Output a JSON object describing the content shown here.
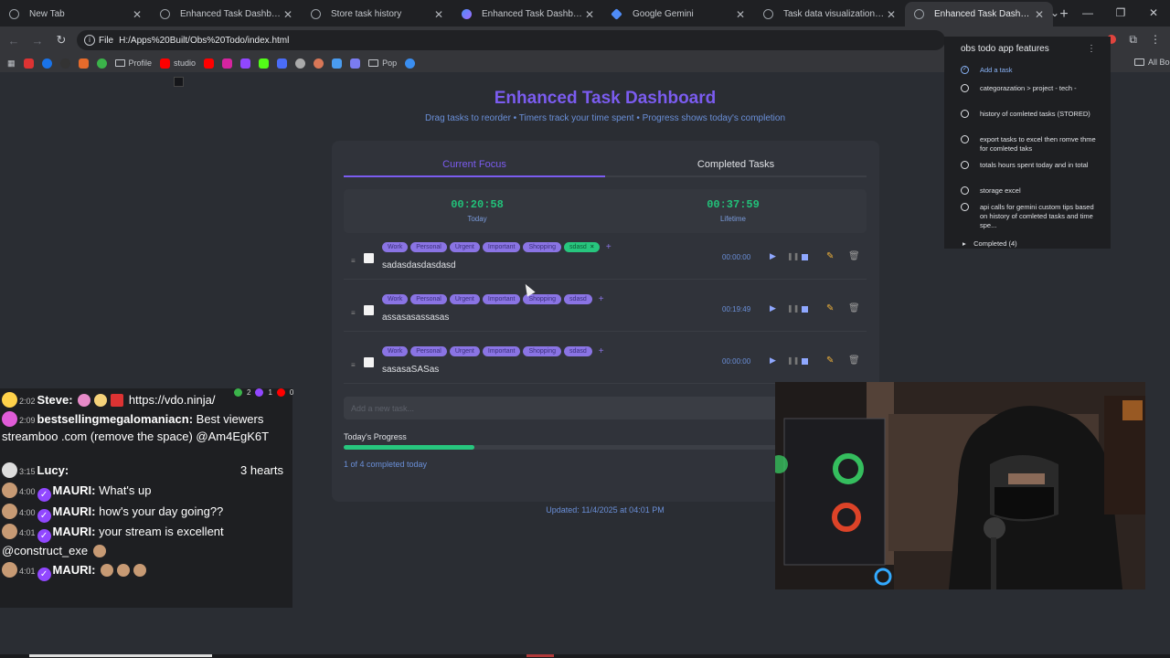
{
  "tabs": [
    {
      "title": "New Tab",
      "active": false,
      "fav": "globe-icon"
    },
    {
      "title": "Enhanced Task Dashboard (Dai",
      "active": false,
      "fav": "globe-icon"
    },
    {
      "title": "Store task history",
      "active": false,
      "fav": "globe-icon"
    },
    {
      "title": "Enhanced Task Dashboard with",
      "active": false,
      "fav": "app-icon"
    },
    {
      "title": "Google Gemini",
      "active": false,
      "fav": "gemini-icon"
    },
    {
      "title": "Task data visualization solution",
      "active": false,
      "fav": "globe-icon"
    },
    {
      "title": "Enhanced Task Dashboard (Dai",
      "active": true,
      "fav": "globe-icon"
    }
  ],
  "address": {
    "scheme": "File",
    "url": "H:/Apps%20Built/Obs%20Todo/index.html"
  },
  "bookmarks": [
    "Profile",
    "studio",
    "Pop",
    "All Bookmarks"
  ],
  "dashboard": {
    "title": "Enhanced Task Dashboard",
    "subtitle": "Drag tasks to reorder • Timers track your time spent • Progress shows today's completion",
    "tabs": {
      "current": "Current Focus",
      "completed": "Completed Tasks"
    },
    "timers": {
      "today_value": "00:20:58",
      "today_label": "Today",
      "lifetime_value": "00:37:59",
      "lifetime_label": "Lifetime"
    },
    "tags": [
      "Work",
      "Personal",
      "Urgent",
      "Important",
      "Shopping",
      "sdasd"
    ],
    "tasks": [
      {
        "name": "sadasdasdasdasd",
        "time": "00:00:00",
        "selected_tag": "sdasd"
      },
      {
        "name": "assasasassasas",
        "time": "00:19:49",
        "selected_tag": ""
      },
      {
        "name": "sasasaSASas",
        "time": "00:00:00",
        "selected_tag": ""
      }
    ],
    "new_task_placeholder": "Add a new task...",
    "progress": {
      "label": "Today's Progress",
      "fraction": 0.25,
      "text": "1 of 4 completed today"
    },
    "updated": "Updated: 11/4/2025 at 04:01 PM",
    "colors": {
      "accent": "#7b5cf0",
      "success": "#27c67e",
      "tag": "#8a74e4"
    }
  },
  "google_tasks": {
    "title": "obs todo app features",
    "add": "Add a task",
    "items": [
      "categorazation > project - tech -",
      "history of comleted tasks (STORED)",
      "export tasks to excel then romve thme for comleted taks",
      "totals hours spent today and in total",
      "storage excel",
      "api calls for gemini custom tips based on history of comleted tasks and time spe..."
    ],
    "completed": "Completed (4)"
  },
  "chat": {
    "badges": [
      "2",
      "1",
      "0"
    ],
    "messages": [
      {
        "time": "2:02",
        "name": "Steve:",
        "text": "https://vdo.ninja/",
        "color": "#ffd24a"
      },
      {
        "time": "2:09",
        "name": "bestsellingmegalomaniacn:",
        "text": "Best viewers streamboo .com (remove the space) @Am4EgK6T",
        "color": "#e05cd8"
      },
      {
        "time": "3:15",
        "name": "Lucy:",
        "text": "",
        "right": "3 hearts",
        "color": "#dddddd"
      },
      {
        "time": "4:00",
        "name": "MAURI:",
        "text": "What's up",
        "color": "#c79a74"
      },
      {
        "time": "4:00",
        "name": "MAURI:",
        "text": "how's your day going??",
        "color": "#c79a74"
      },
      {
        "time": "4:01",
        "name": "MAURI:",
        "text": "your stream is excellent @construct_exe",
        "color": "#c79a74"
      },
      {
        "time": "4:01",
        "name": "MAURI:",
        "text": "",
        "color": "#c79a74"
      }
    ]
  }
}
